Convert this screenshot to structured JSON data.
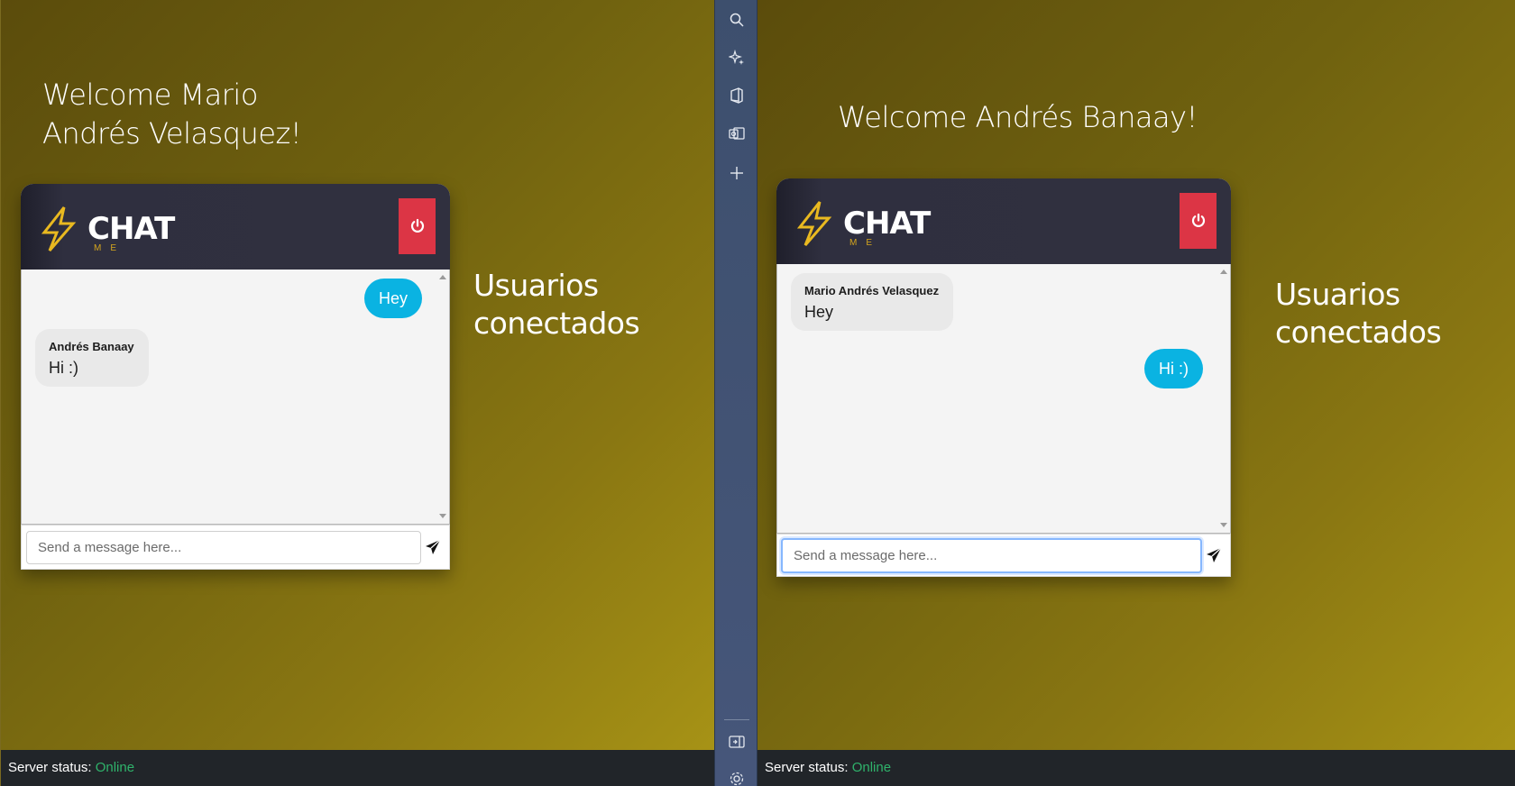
{
  "left": {
    "welcome": "Welcome Mario Andrés Velasquez!",
    "users_title": "Usuarios conectados",
    "chat": {
      "logo": {
        "main": "CHAT",
        "sub": "ME"
      },
      "messages": [
        {
          "from": "me",
          "text": "Hey"
        },
        {
          "from": "other",
          "author": "Andrés Banaay",
          "text": "Hi :)"
        }
      ],
      "input": {
        "value": "",
        "placeholder": "Send a message here..."
      }
    },
    "status": {
      "label": "Server status:",
      "value": "Online"
    }
  },
  "right": {
    "welcome": "Welcome Andrés Banaay!",
    "users_title": "Usuarios conectados",
    "chat": {
      "logo": {
        "main": "CHAT",
        "sub": "ME"
      },
      "messages": [
        {
          "from": "other",
          "author": "Mario Andrés Velasquez",
          "text": "Hey"
        },
        {
          "from": "me",
          "text": "Hi :)"
        }
      ],
      "input": {
        "value": "",
        "placeholder": "Send a message here..."
      }
    },
    "status": {
      "label": "Server status:",
      "value": "Online"
    }
  },
  "toolbar": {
    "icons": [
      "search-icon",
      "sparkle-icon",
      "office-icon",
      "outlook-icon",
      "plus-icon",
      "sidebar-collapse-icon",
      "settings-icon"
    ]
  },
  "colors": {
    "accent_blue": "#0ab3e2",
    "power_red": "#dc3545",
    "online_green": "#2fb36b",
    "logo_yellow": "#e9b920"
  }
}
